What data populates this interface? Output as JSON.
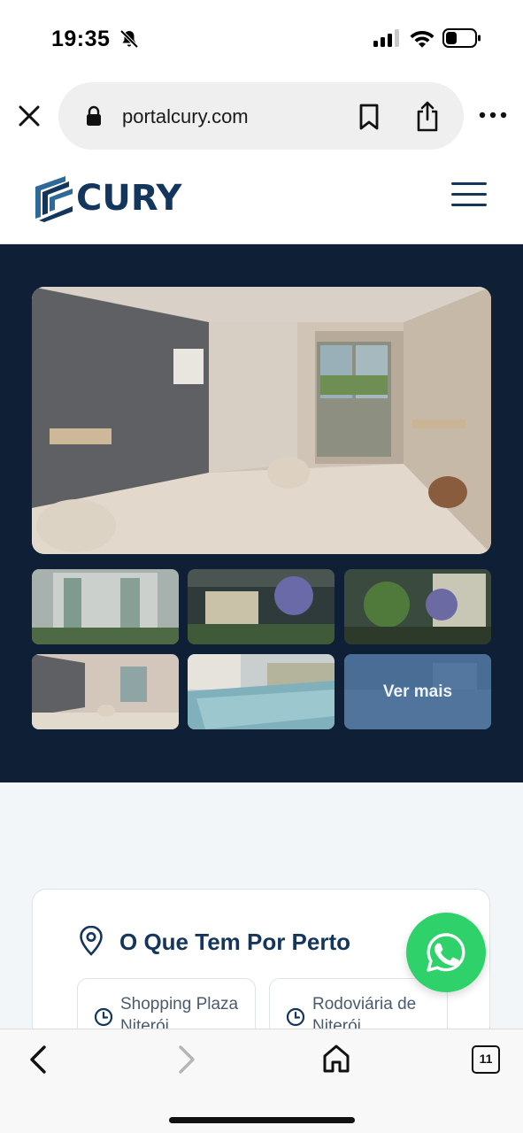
{
  "status_bar": {
    "time": "19:35",
    "icons": [
      "bell-slash-icon",
      "signal-icon",
      "wifi-icon",
      "battery-icon"
    ]
  },
  "browser": {
    "url": "portalcury.com",
    "icons": [
      "close-icon",
      "lock-icon",
      "bookmark-icon",
      "share-icon",
      "more-icon"
    ]
  },
  "site": {
    "logo_text": "CURY",
    "brand_color": "#15365c",
    "menu_icon": "hamburger-menu-icon"
  },
  "gallery": {
    "background": "#0e1f36",
    "photos": [
      "hero-lounge-photo",
      "building-facade-photo",
      "entrance-photo",
      "garden-photo",
      "lounge-photo",
      "pool-photo"
    ],
    "more_label": "Ver mais"
  },
  "nearby": {
    "title": "O Que Tem Por Perto",
    "places": [
      {
        "name": "Shopping Plaza Niterói"
      },
      {
        "name": "Rodoviária de Niterói"
      }
    ]
  },
  "whatsapp": {
    "color": "#2fd16a"
  },
  "toolbar": {
    "tab_count": "11"
  }
}
